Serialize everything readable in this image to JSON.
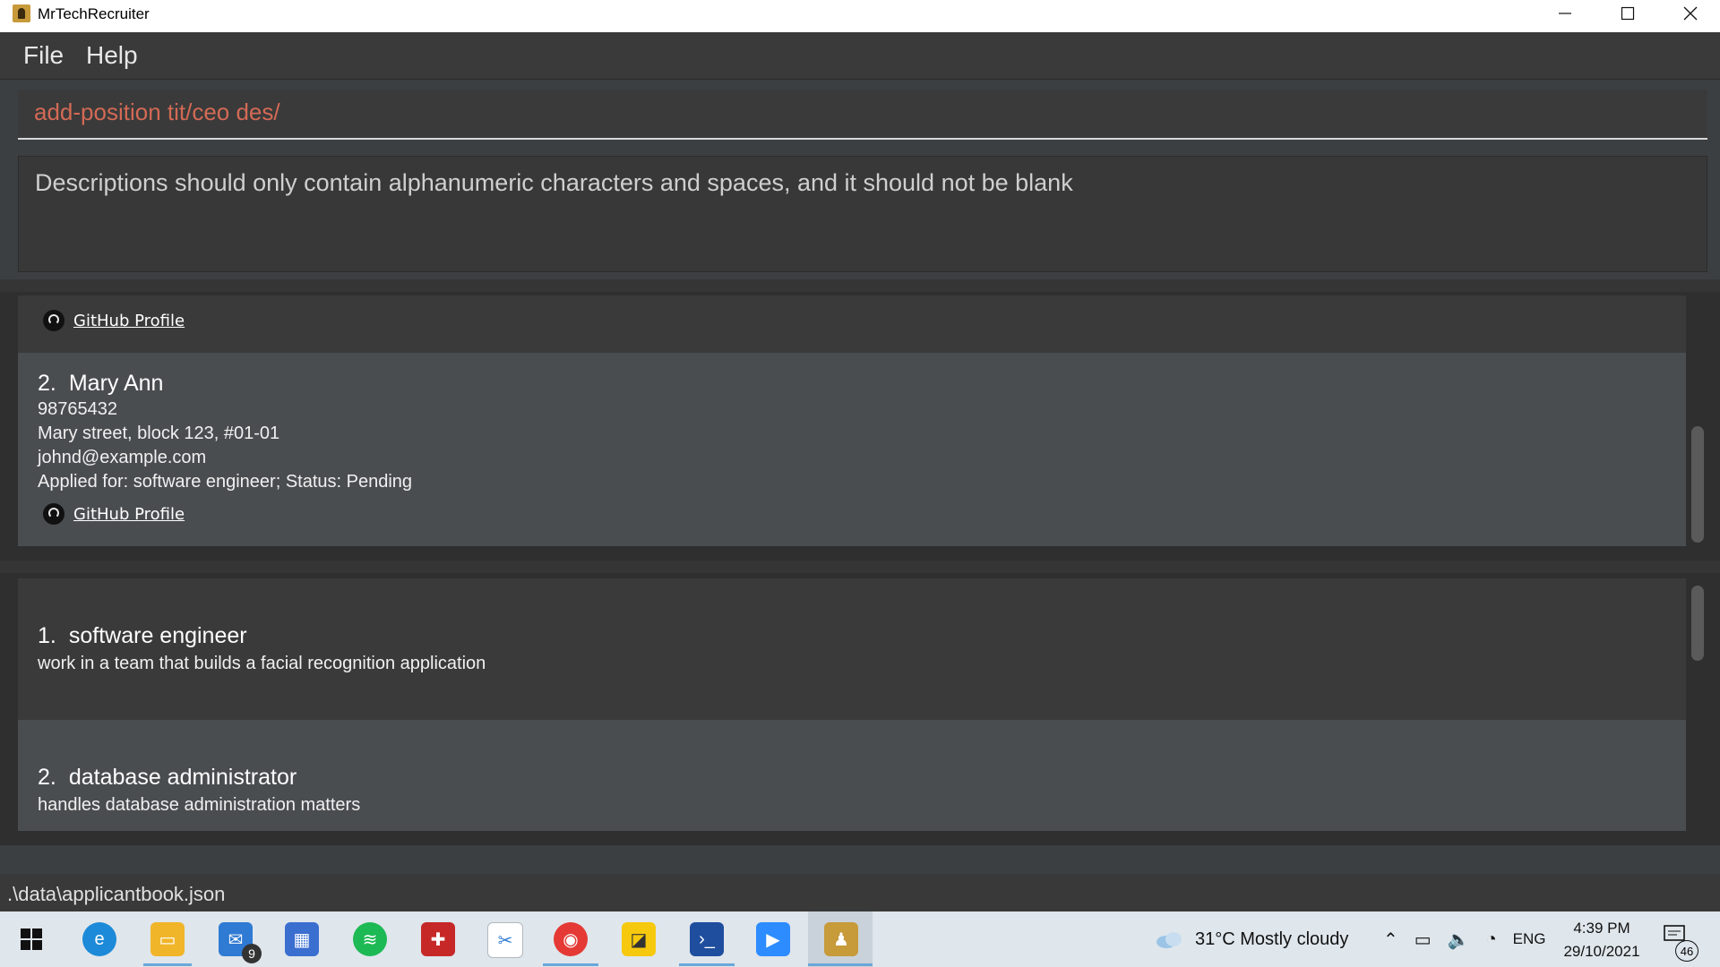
{
  "window": {
    "title": "MrTechRecruiter"
  },
  "menu": {
    "file": "File",
    "help": "Help"
  },
  "command": {
    "text": "add-position tit/ceo des/"
  },
  "result": {
    "message": "Descriptions should only contain alphanumeric characters and spaces, and it should not be blank"
  },
  "applicants": {
    "partial_card": {
      "github_label": "GitHub Profile"
    },
    "items": [
      {
        "index": "2.",
        "name": "Mary Ann",
        "phone": "98765432",
        "address": "Mary street, block 123, #01-01",
        "email": "johnd@example.com",
        "applied": "Applied for: software engineer; Status: Pending",
        "github_label": "GitHub Profile"
      }
    ]
  },
  "positions": {
    "items": [
      {
        "index": "1.",
        "title": "software engineer",
        "description": "work in a team that builds a facial recognition application"
      },
      {
        "index": "2.",
        "title": "database administrator",
        "description": "handles database administration matters"
      }
    ]
  },
  "status": {
    "path": ".\\data\\applicantbook.json"
  },
  "taskbar": {
    "mail_badge": "9",
    "weather": "31°C  Mostly cloudy",
    "language": "ENG",
    "time": "4:39 PM",
    "date": "29/10/2021",
    "notifications": "46"
  },
  "colors": {
    "command_text": "#d36a55",
    "card_dark": "#3a3a3a",
    "card_light": "#4a4d50"
  }
}
